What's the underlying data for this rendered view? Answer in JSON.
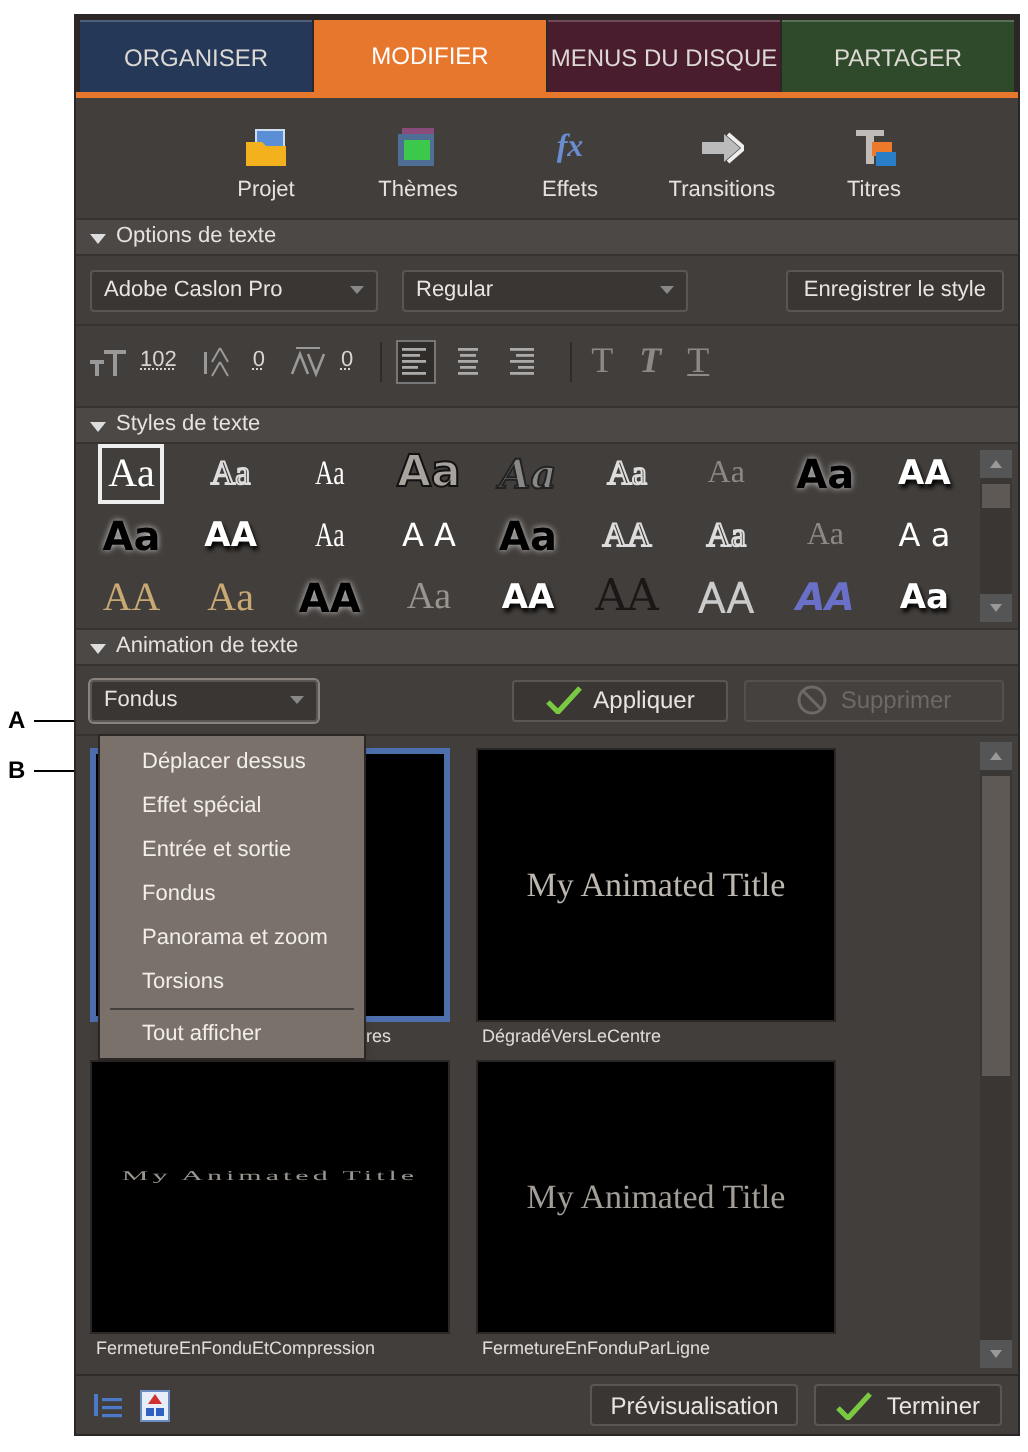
{
  "callouts": [
    {
      "label": "A"
    },
    {
      "label": "B"
    }
  ],
  "tabs": [
    {
      "label": "ORGANISER",
      "selected": false,
      "color": "#253858"
    },
    {
      "label": "MODIFIER",
      "selected": true,
      "color": "#e8772e"
    },
    {
      "label": "MENUS DU DISQUE",
      "selected": false,
      "color": "#4a1d2e"
    },
    {
      "label": "PARTAGER",
      "selected": false,
      "color": "#2f4a2b"
    }
  ],
  "toolbar": [
    {
      "label": "Projet",
      "kind": "folder"
    },
    {
      "label": "Thèmes",
      "kind": "film"
    },
    {
      "label": "Effets",
      "kind": "fx",
      "glyph": "fx"
    },
    {
      "label": "Transitions",
      "kind": "arrow"
    },
    {
      "label": "Titres",
      "kind": "titles"
    }
  ],
  "text_options": {
    "title": "Options de texte",
    "expanded": true,
    "font": "Adobe Caslon Pro",
    "font_style": "Regular",
    "save_button": "Enregistrer le style",
    "size": "102",
    "leading": "0",
    "kerning": "0",
    "alignment": [
      {
        "kind": "left",
        "selected": true
      },
      {
        "kind": "center",
        "selected": false
      },
      {
        "kind": "right",
        "selected": false
      }
    ],
    "type_styles": [
      {
        "label": "T",
        "kind": "regular"
      },
      {
        "label": "T",
        "kind": "italic"
      },
      {
        "label": "T",
        "kind": "underline"
      }
    ]
  },
  "text_styles": {
    "title": "Styles de texte",
    "expanded": true,
    "samples": [
      {
        "text": "Aa",
        "kind": "serif",
        "selected": true
      },
      {
        "text": "Aa",
        "kind": "outline",
        "selected": false
      },
      {
        "text": "Aa",
        "kind": "condensed",
        "selected": false
      },
      {
        "text": "Aa",
        "kind": "heavy",
        "selected": false
      },
      {
        "text": "Aa",
        "kind": "script",
        "selected": false
      },
      {
        "text": "Aa",
        "kind": "outline",
        "selected": false
      },
      {
        "text": "Aa",
        "kind": "ghost",
        "selected": false
      },
      {
        "text": "Aa",
        "kind": "black",
        "selected": false
      },
      {
        "text": "AA",
        "kind": "sans-bold",
        "selected": false
      },
      {
        "text": "Aa",
        "kind": "black",
        "selected": false
      },
      {
        "text": "AA",
        "kind": "sans-bold",
        "selected": false
      },
      {
        "text": "Aa",
        "kind": "condensed",
        "selected": false
      },
      {
        "text": "A A",
        "kind": "sans",
        "selected": false
      },
      {
        "text": "Aa",
        "kind": "black",
        "selected": false
      },
      {
        "text": "AA",
        "kind": "outline",
        "selected": false
      },
      {
        "text": "Aa",
        "kind": "outline",
        "selected": false
      },
      {
        "text": "Aa",
        "kind": "ghost",
        "selected": false
      },
      {
        "text": "A a",
        "kind": "sans",
        "selected": false
      },
      {
        "text": "AA",
        "kind": "gold",
        "selected": false
      },
      {
        "text": "Aa",
        "kind": "gold",
        "selected": false
      },
      {
        "text": "AA",
        "kind": "black",
        "selected": false
      },
      {
        "text": "Aa",
        "kind": "dim",
        "selected": false
      },
      {
        "text": "AA",
        "kind": "sans-bold",
        "selected": false
      },
      {
        "text": "AA",
        "kind": "dark",
        "selected": false
      },
      {
        "text": "AA",
        "kind": "thin",
        "selected": false
      },
      {
        "text": "AA",
        "kind": "blue",
        "selected": false
      },
      {
        "text": "Aa",
        "kind": "sans-bold",
        "selected": false
      }
    ]
  },
  "text_animation": {
    "title": "Animation de texte",
    "expanded": true,
    "category": {
      "value": "Fondus",
      "expanded": true,
      "options": [
        "Déplacer dessus",
        "Effet spécial",
        "Entrée et sortie",
        "Fondus",
        "Panorama et zoom",
        "Torsions"
      ],
      "footer_option": "Tout afficher"
    },
    "apply_button": {
      "label": "Appliquer",
      "disabled": false
    },
    "delete_button": {
      "label": "Supprimer",
      "disabled": true
    },
    "presets": [
      {
        "caption": "res",
        "selected": true
      },
      {
        "caption": "DégradéVersLeCentre",
        "selected": false,
        "preview": "My Animated Title",
        "kind": "normal"
      },
      {
        "caption": "FermetureEnFonduEtCompression",
        "selected": false,
        "preview": "My Animated Title",
        "kind": "squashed"
      },
      {
        "caption": "FermetureEnFonduParLigne",
        "selected": false,
        "preview": "My Animated Title",
        "kind": "dim"
      }
    ]
  },
  "footer": {
    "preview_button": "Prévisualisation",
    "done_button": "Terminer"
  }
}
